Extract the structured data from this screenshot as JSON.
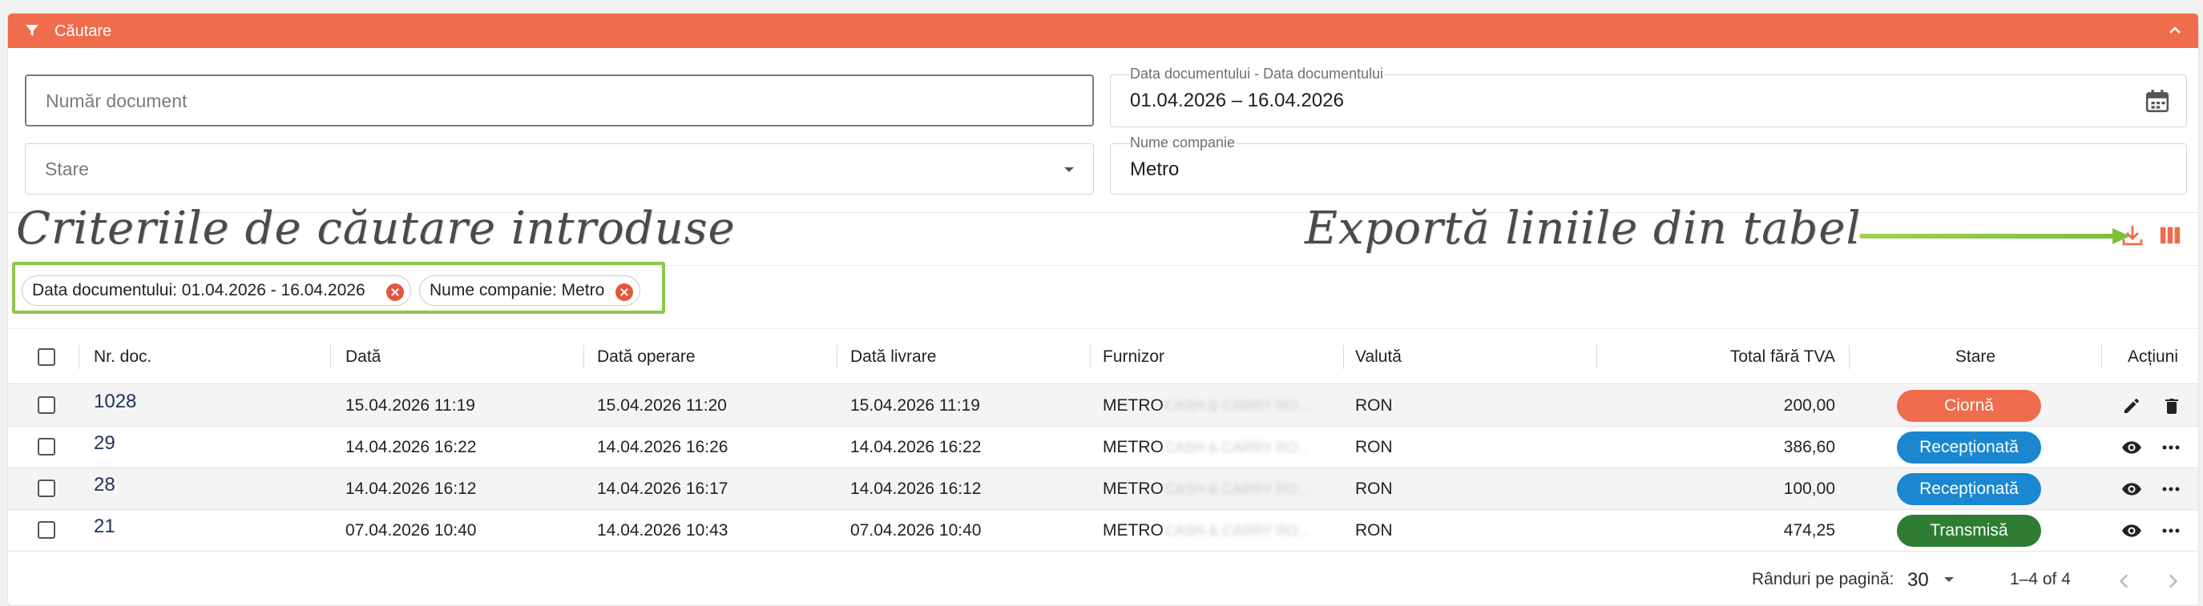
{
  "header": {
    "title": "Căutare"
  },
  "form": {
    "doc_number_placeholder": "Număr document",
    "date_label": "Data documentului - Data documentului",
    "date_value": "01.04.2026 – 16.04.2026",
    "state_placeholder": "Stare",
    "company_label": "Nume companie",
    "company_value": "Metro"
  },
  "annotations": {
    "search_criteria": "Criteriile de căutare introduse",
    "export": "Exportă liniile din tabel"
  },
  "chips": [
    {
      "label": "Data documentului: 01.04.2026 - 16.04.2026"
    },
    {
      "label": "Nume companie: Metro"
    }
  ],
  "table": {
    "headers": {
      "doc_no": "Nr. doc.",
      "date": "Dată",
      "op_date": "Dată operare",
      "delivery_date": "Dată livrare",
      "supplier": "Furnizor",
      "currency": "Valută",
      "total": "Total fără TVA",
      "state": "Stare",
      "actions": "Acțiuni"
    },
    "rows": [
      {
        "doc_no": "1028",
        "date": "15.04.2026 11:19",
        "op_date": "15.04.2026 11:20",
        "delivery_date": "15.04.2026 11:19",
        "supplier": "METRO",
        "supplier_rest": "CASH & CARRY RO...",
        "currency": "RON",
        "total": "200,00",
        "state": "Ciornă",
        "state_color": "#ef6c4c"
      },
      {
        "doc_no": "29",
        "date": "14.04.2026 16:22",
        "op_date": "14.04.2026 16:26",
        "delivery_date": "14.04.2026 16:22",
        "supplier": "METRO",
        "supplier_rest": "CASH & CARRY RO...",
        "currency": "RON",
        "total": "386,60",
        "state": "Recepționată",
        "state_color": "#1a87d0"
      },
      {
        "doc_no": "28",
        "date": "14.04.2026 16:12",
        "op_date": "14.04.2026 16:17",
        "delivery_date": "14.04.2026 16:12",
        "supplier": "METRO",
        "supplier_rest": "CASH & CARRY RO...",
        "currency": "RON",
        "total": "100,00",
        "state": "Recepționată",
        "state_color": "#1a87d0"
      },
      {
        "doc_no": "21",
        "date": "07.04.2026 10:40",
        "op_date": "14.04.2026 10:43",
        "delivery_date": "07.04.2026 10:40",
        "supplier": "METRO",
        "supplier_rest": "CASH & CARRY RO...",
        "currency": "RON",
        "total": "474,25",
        "state": "Transmisă",
        "state_color": "#2e7d32"
      }
    ]
  },
  "footer": {
    "rows_per_page_label": "Rânduri pe pagină:",
    "rows_per_page_value": "30",
    "range": "1–4 of 4"
  },
  "colors": {
    "accent": "#ef6c4c",
    "highlight": "#8cc84b"
  }
}
